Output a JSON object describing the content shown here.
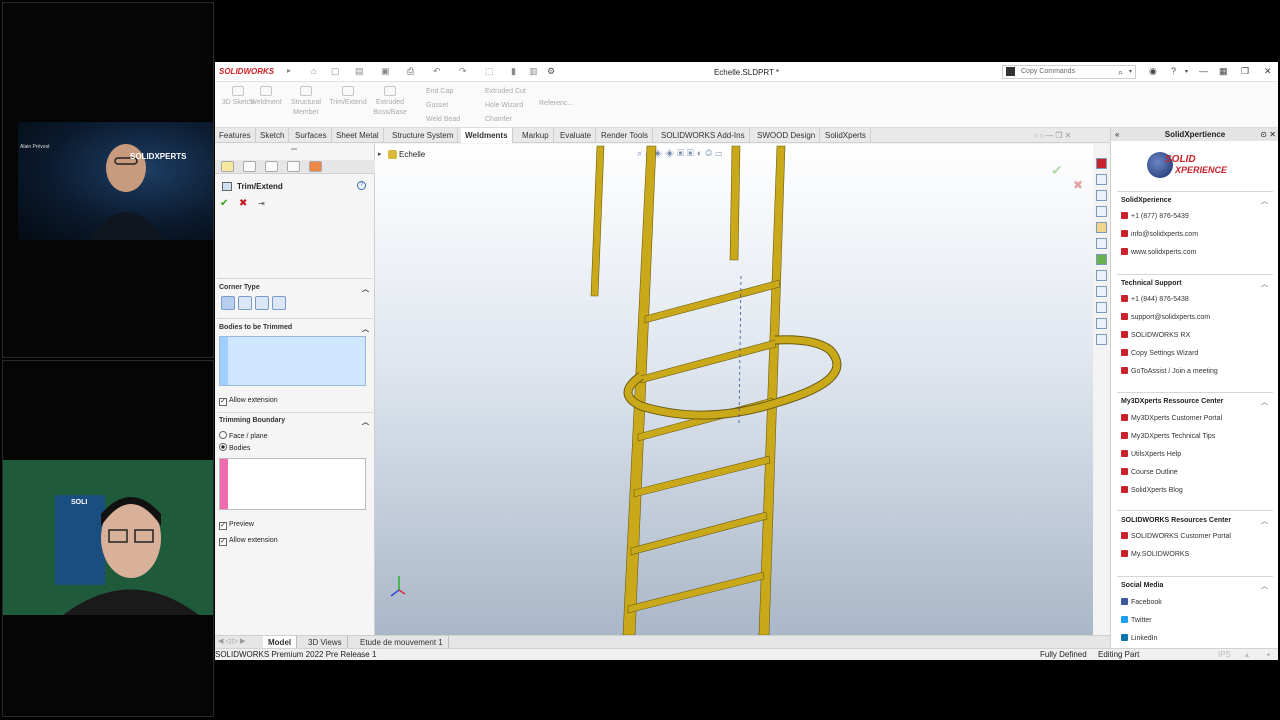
{
  "webcam_top": {
    "overlay_logo": "SOLIDXPERTS",
    "name_caption": "Alain Prévost"
  },
  "webcam_bottom": {
    "poster_text": "SOLI"
  },
  "titlebar": {
    "brand": "SOLIDWORKS",
    "document_title": "Echelle.SLDPRT *",
    "search_placeholder": "Copy Commands"
  },
  "command_bar": {
    "items": [
      {
        "label": "3D Sketch",
        "icon": "3d-sketch-icon"
      },
      {
        "label": "Weldment",
        "icon": "weldment-icon"
      },
      {
        "label": "Structural Member",
        "icon": "structural-member-icon"
      },
      {
        "label": "Trim/Extend",
        "icon": "trim-extend-icon"
      },
      {
        "label": "Extruded Boss/Base",
        "icon": "extruded-boss-icon"
      }
    ],
    "small_items": [
      "End Cap",
      "Gusset",
      "Weld Bead",
      "Extruded Cut",
      "Hole Wizard",
      "Chamfer",
      "Referenc..."
    ]
  },
  "tabs": [
    "Features",
    "Sketch",
    "Surfaces",
    "Sheet Metal",
    "Structure System",
    "Weldments",
    "Markup",
    "Evaluate",
    "Render Tools",
    "SOLIDWORKS Add-Ins",
    "SWOOD Design",
    "SolidXperts"
  ],
  "active_tab": "Weldments",
  "property_manager": {
    "title": "Trim/Extend",
    "corner_type_label": "Corner Type",
    "bodies_trimmed_label": "Bodies to be Trimmed",
    "allow_extension_1": "Allow extension",
    "trimming_boundary_label": "Trimming Boundary",
    "radio_face": "Face / plane",
    "radio_bodies": "Bodies",
    "selected_radio": "Bodies",
    "preview_label": "Preview",
    "allow_extension_2": "Allow extension",
    "accent_blue": "#9fd0ff",
    "accent_pink": "#f06ab0"
  },
  "viewport": {
    "tree_label": "Echelle",
    "part_color": "#c9a91a"
  },
  "task_pane": {
    "title": "SolidXpertience",
    "logo_text_1": "SOLID",
    "logo_text_2": "XPERIENCE",
    "sections": [
      {
        "title": "SolidXperience",
        "items": [
          "+1 (877) 876-5439",
          "info@solidxperts.com",
          "www.solidxperts.com"
        ]
      },
      {
        "title": "Technical Support",
        "items": [
          "+1 (844) 876-5438",
          "support@solidxperts.com",
          "SOLIDWORKS RX",
          "Copy Settings Wizard",
          "GoToAssist / Join a meeting"
        ]
      },
      {
        "title": "My3DXperts Ressource Center",
        "items": [
          "My3DXperts Customer Portal",
          "My3DXperts Technical Tips",
          "UtilsXperts Help",
          "Course Outline",
          "SolidXperts Blog"
        ]
      },
      {
        "title": "SOLIDWORKS Resources Center",
        "items": [
          "SOLIDWORKS Customer Portal",
          "My.SOLIDWORKS"
        ]
      },
      {
        "title": "Social Media",
        "items": [
          "Facebook",
          "Twitter",
          "LinkedIn"
        ]
      }
    ]
  },
  "bottom_tabs": [
    "Model",
    "3D Views",
    "Etude de mouvement 1"
  ],
  "active_bottom_tab": "Model",
  "status_bar": {
    "version": "SOLIDWORKS Premium 2022 Pre Release 1",
    "state": "Fully Defined",
    "mode": "Editing Part",
    "units": "IPS"
  }
}
